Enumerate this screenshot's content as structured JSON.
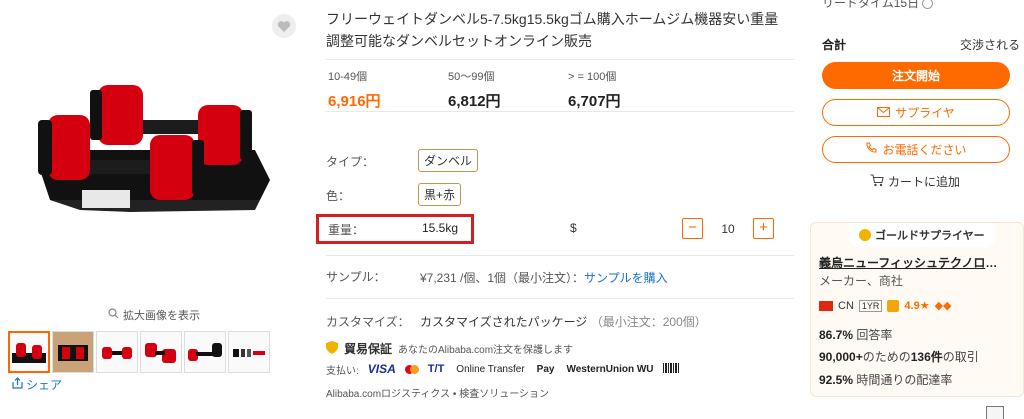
{
  "gallery": {
    "zoom_hint": "拡大画像を表示",
    "share_label": "シェア",
    "thumb_count": 6
  },
  "product": {
    "title": "フリーウェイトダンベル5-7.5kg15.5kgゴム購入ホームジム機器安い重量調整可能なダンベルセットオンライン販売",
    "prices": [
      {
        "range": "10-49個",
        "price": "6,916円",
        "highlight": true
      },
      {
        "range": "50～99個",
        "price": "6,812円",
        "highlight": false
      },
      {
        "range": "> = 100個",
        "price": "6,707円",
        "highlight": false
      }
    ],
    "attributes": {
      "type_label": "タイプ：",
      "type_value": "ダンベル",
      "color_label": "色：",
      "color_value": "黒+赤",
      "weight_label": "重量：",
      "weight_value": "15.5kg",
      "currency_symbol": "$",
      "quantity": "10",
      "minus": "−",
      "plus": "+"
    },
    "sample": {
      "label": "サンプル：",
      "text": "¥7,231 /個、1個（最小注文）：",
      "link": "サンプルを購入"
    },
    "customization": {
      "label": "カスタマイズ：",
      "text": "カスタマイズされたパッケージ",
      "min": "（最小注文：200個）"
    },
    "assurance": {
      "title": "貿易保証",
      "subtitle": "あなたのAlibaba.com注文を保護します"
    },
    "payment": {
      "label": "支払い:",
      "methods": [
        "VISA",
        "T/T",
        "Online Transfer",
        "Pay",
        "WesternUnion",
        "WU"
      ]
    },
    "logistics": {
      "left": "Alibaba.comロジスティクス",
      "separator": "•",
      "right": "検査ソリューション"
    }
  },
  "order_panel": {
    "top_cut_text": "リードタイム15日",
    "total_label": "合計",
    "total_value": "交渉される",
    "start_order": "注文開始",
    "supplier_btn": "サプライヤ",
    "call_btn": "お電話ください",
    "add_cart": "カートに追加"
  },
  "supplier": {
    "badge": "ゴールドサプライヤー",
    "name": "義烏ニューフィッシュテクノロジー",
    "type": "メーカー、商社",
    "country": "CN",
    "years": "1YR",
    "rating": "4.9",
    "response_rate": "86.7%",
    "response_label": "回答率",
    "transactions_prefix": "90,000+",
    "transactions_mid": "のための",
    "transactions_count": "136件",
    "transactions_suffix": "の取引",
    "ontime": "92.5%",
    "ontime_label": "時間通りの配達率"
  },
  "colors": {
    "accent": "#ff6a00",
    "highlight_box": "#d21f1f",
    "link": "#1a70d6"
  }
}
